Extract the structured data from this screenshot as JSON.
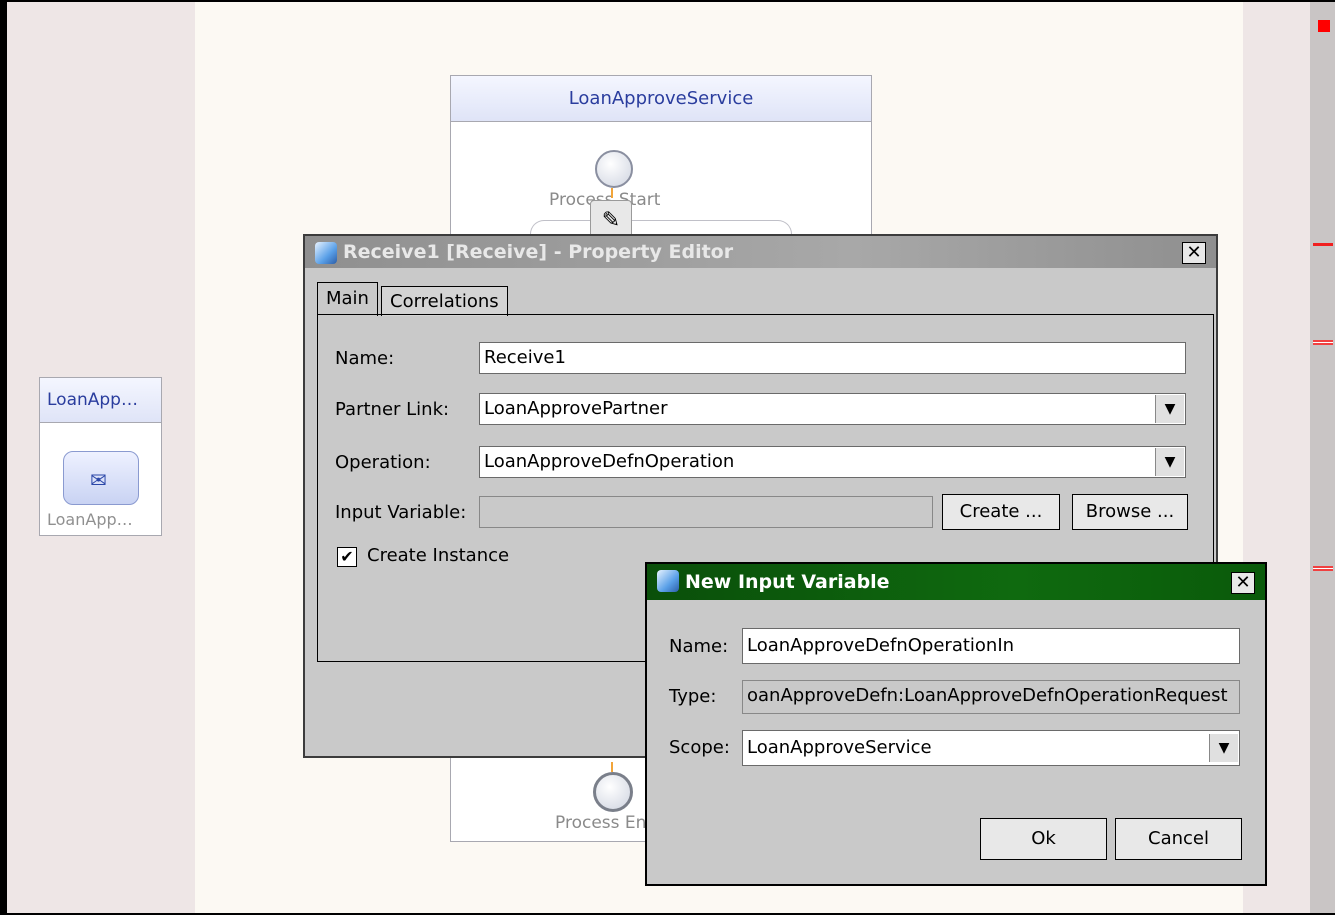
{
  "partner_box": {
    "title": "LoanApp…",
    "label": "LoanApp…"
  },
  "process": {
    "title": "LoanApproveService",
    "start_label": "Process Start",
    "end_label": "Process End"
  },
  "property_editor": {
    "title": "Receive1 [Receive] - Property Editor",
    "close": "✕",
    "tabs": [
      {
        "label": "Main"
      },
      {
        "label": "Correlations"
      }
    ],
    "fields": {
      "name_label": "Name:",
      "name_value": "Receive1",
      "partner_link_label": "Partner Link:",
      "partner_link_value": "LoanApprovePartner",
      "operation_label": "Operation:",
      "operation_value": "LoanApproveDefnOperation",
      "input_variable_label": "Input Variable:",
      "input_variable_value": ""
    },
    "create_button": "Create ...",
    "browse_button": "Browse ...",
    "create_instance_label": "Create Instance",
    "create_instance_checked": true
  },
  "new_input_variable": {
    "title": "New Input Variable",
    "close": "✕",
    "name_label": "Name:",
    "name_value": "LoanApproveDefnOperationIn",
    "type_label": "Type:",
    "type_value": "oanApproveDefn:LoanApproveDefnOperationRequest",
    "scope_label": "Scope:",
    "scope_value": "LoanApproveService",
    "ok_button": "Ok",
    "cancel_button": "Cancel"
  },
  "icons": {
    "window_icon": "cube-icon",
    "dropdown": "▼",
    "checkmark": "✔",
    "envelope": "✉",
    "edit": "✎"
  },
  "colors": {
    "pe_titlebar": "#9a9a9a",
    "niv_titlebar": "#0f6a0f",
    "header_text": "#2a3d9e",
    "error_marker": "#ff0000"
  }
}
